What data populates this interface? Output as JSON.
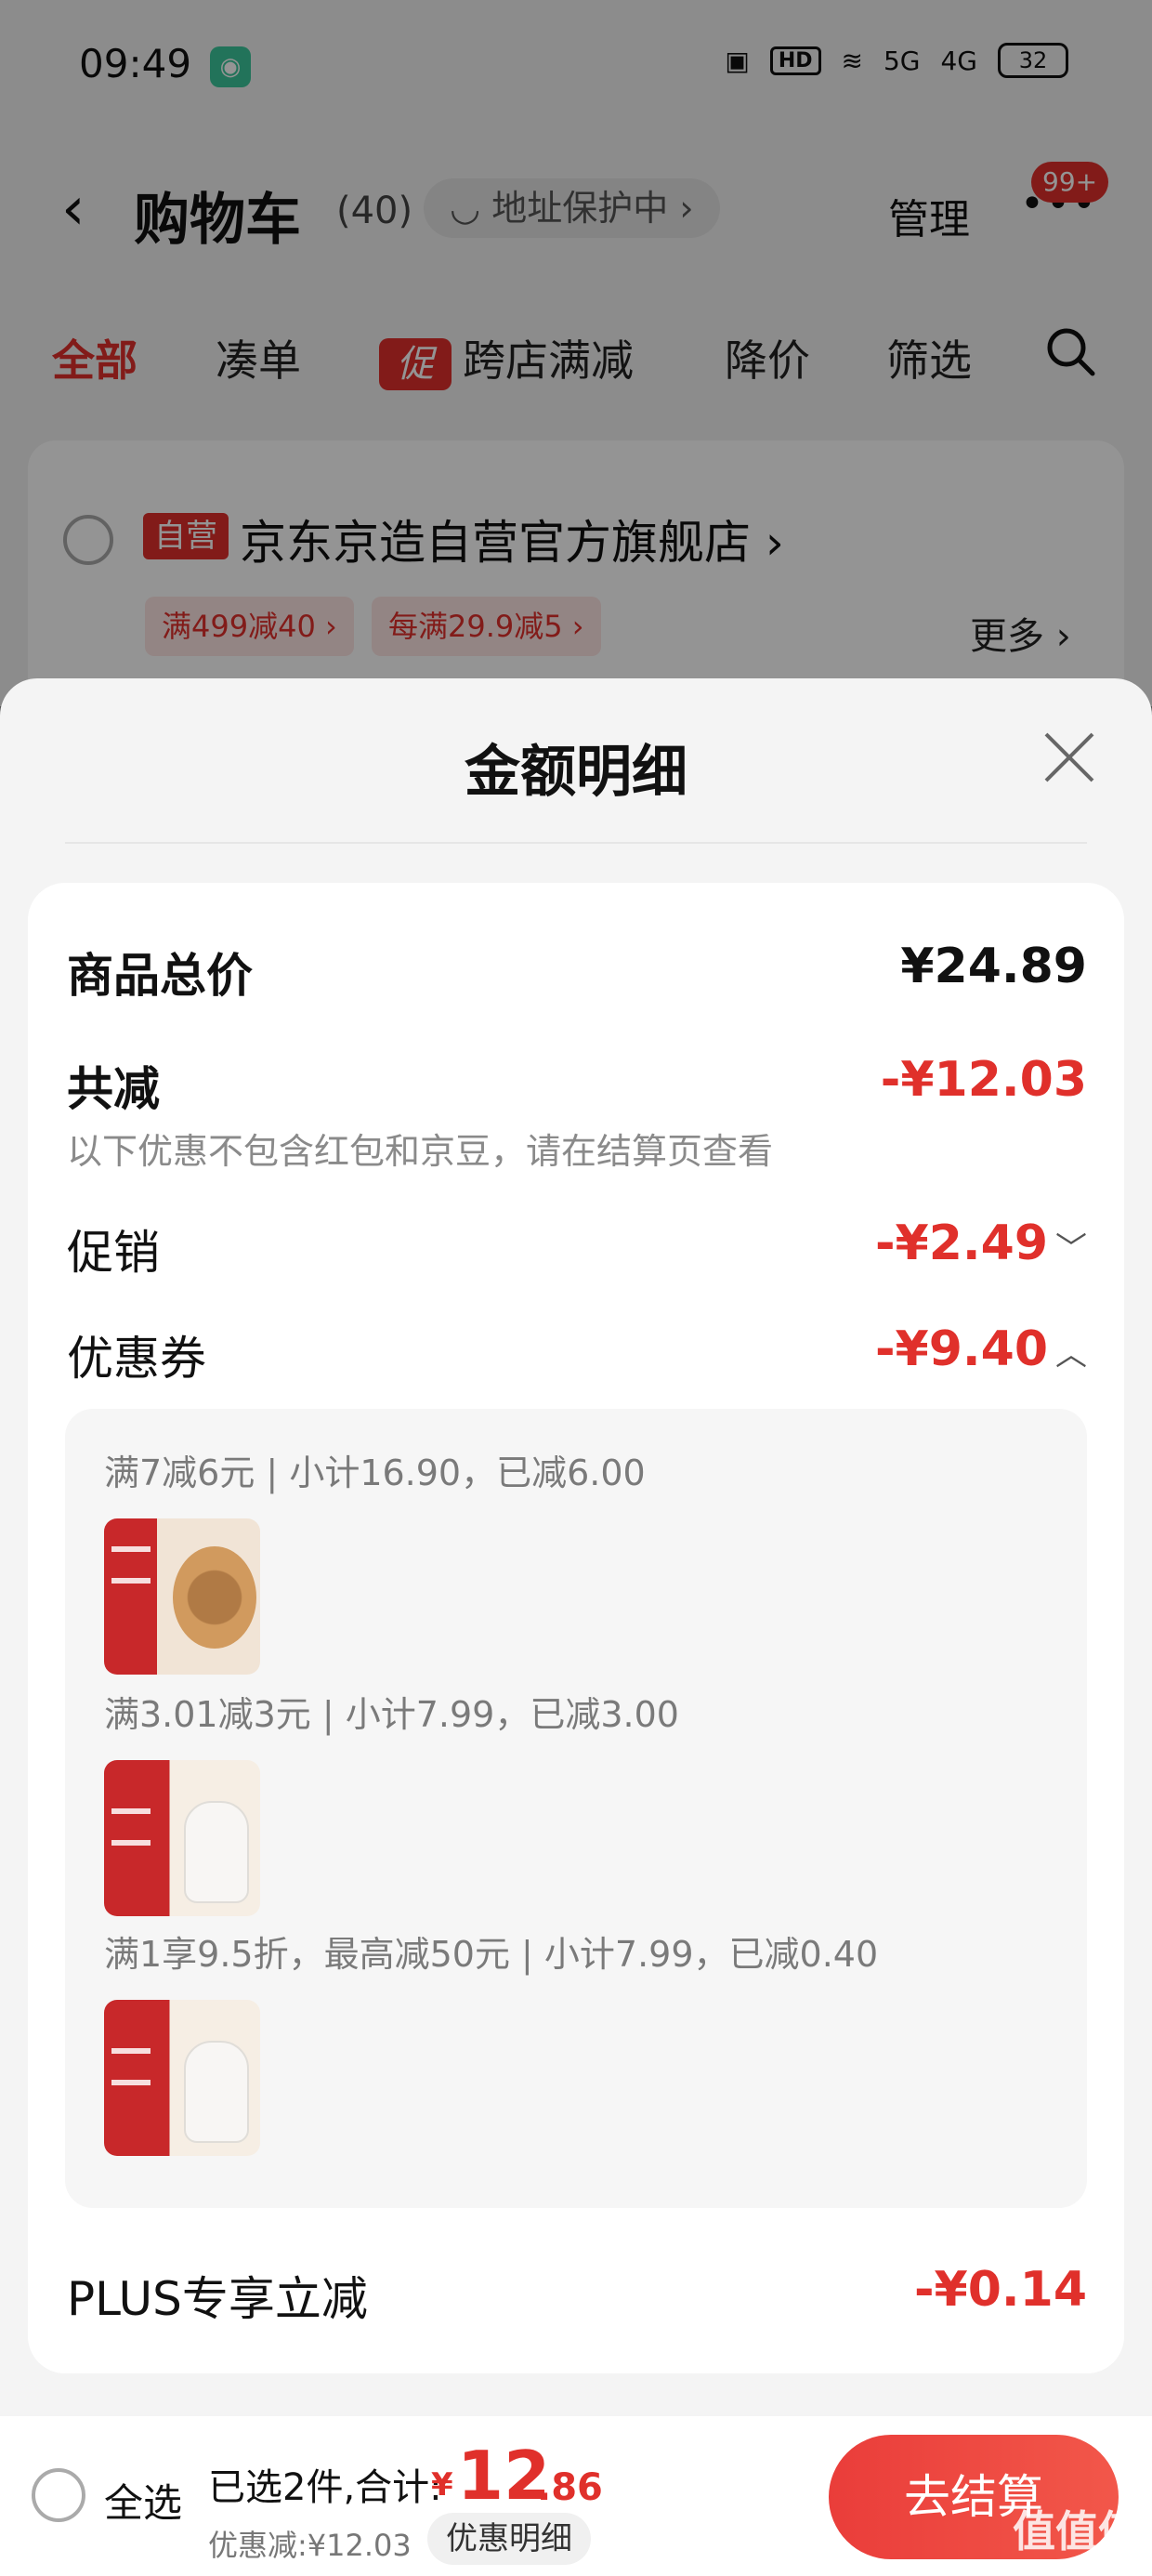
{
  "status_bar": {
    "time": "09:49",
    "app_icon": "mi-home-icon",
    "network": "HD",
    "signal_5g": "5G",
    "signal_4g": "4G",
    "battery": "32"
  },
  "nav": {
    "title": "购物车",
    "count": "(40)",
    "address_protect": "地址保护中",
    "manage": "管理",
    "badge": "99+"
  },
  "tabs": {
    "all": "全部",
    "bundle": "凑单",
    "promo_badge": "促",
    "cross_store": "跨店满减",
    "price_drop": "降价",
    "filter": "筛选"
  },
  "store": {
    "tag": "自营",
    "name": "京东京造自营官方旗舰店",
    "coupon1": "满499减40",
    "coupon2": "每满29.9减5",
    "more": "更多"
  },
  "sheet": {
    "title": "金额明细",
    "total_label": "商品总价",
    "total_value": "¥24.89",
    "reduced_label": "共减",
    "reduced_value": "-¥12.03",
    "note": "以下优惠不包含红包和京豆，请在结算页查看",
    "promo_label": "促销",
    "promo_value": "-¥2.49",
    "coupon_label": "优惠券",
    "coupon_value": "-¥9.40",
    "coupon_lines": [
      "满7减6元 | 小计16.90，已减6.00",
      "满3.01减3元 | 小计7.99，已减3.00",
      "满1享9.5折，最高减50元 | 小计7.99，已减0.40"
    ],
    "plus_label": "PLUS专享立减",
    "plus_value": "-¥0.14"
  },
  "bottom_bar": {
    "select_all": "全选",
    "selected_text": "已选2件,合计:",
    "currency": "¥",
    "total_int": "12",
    "total_dec": ".86",
    "discount_text": "优惠减:¥12.03",
    "detail_button": "优惠明细",
    "checkout": "去结算"
  },
  "watermark": "值值值",
  "colors": {
    "accent_red": "#e0302b",
    "sheet_bg": "#f4f4f4"
  }
}
